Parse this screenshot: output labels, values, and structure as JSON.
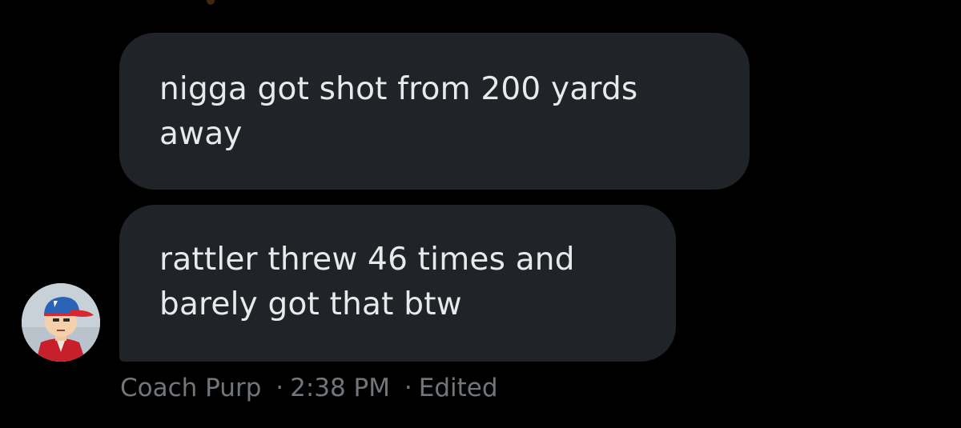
{
  "messages": [
    {
      "text": "nigga got shot from 200 yards away"
    },
    {
      "text": "rattler threw 46 times and barely got that btw"
    }
  ],
  "sender": {
    "name": "Coach Purp",
    "time": "2:38 PM",
    "status": "Edited",
    "separator": "·",
    "avatar_icon": "cartoon-avatar-icon"
  },
  "colors": {
    "background": "#000000",
    "bubble": "#202327",
    "text": "#e7e9ea",
    "meta_text": "#71767b"
  }
}
